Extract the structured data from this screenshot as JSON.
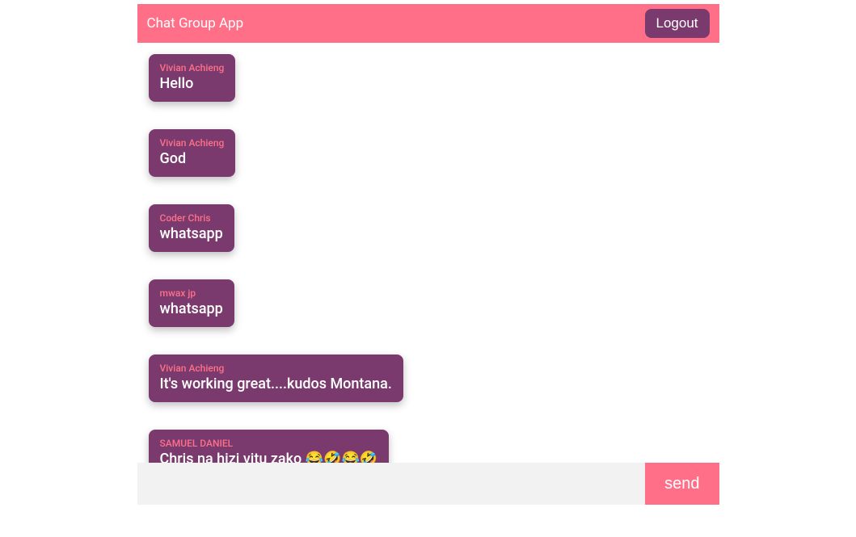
{
  "header": {
    "title": "Chat Group App",
    "logout_label": "Logout"
  },
  "messages": [
    {
      "author": "Vivian Achieng",
      "text": "Hello"
    },
    {
      "author": "Vivian Achieng",
      "text": "God"
    },
    {
      "author": "Coder Chris",
      "text": "whatsapp"
    },
    {
      "author": "mwax jp",
      "text": "whatsapp"
    },
    {
      "author": "Vivian Achieng",
      "text": "It's working great....kudos Montana."
    },
    {
      "author": "SAMUEL DANIEL",
      "text": "Chris na hizi vitu zako 😂🤣😂🤣"
    }
  ],
  "input": {
    "value": "",
    "send_label": "send"
  }
}
